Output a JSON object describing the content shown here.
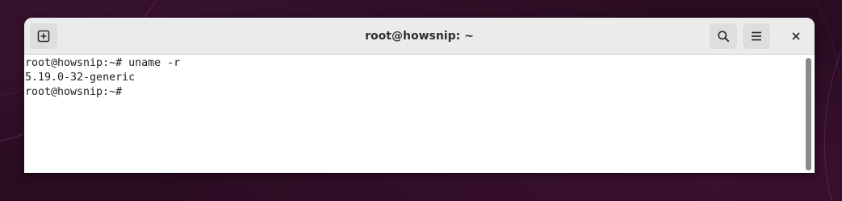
{
  "window": {
    "title": "root@howsnip: ~"
  },
  "headerbar": {
    "new_tab_icon": "plus-in-square-icon",
    "search_icon": "search-icon",
    "menu_icon": "hamburger-menu-icon",
    "close_icon": "close-icon"
  },
  "terminal": {
    "lines": [
      "root@howsnip:~# uname -r",
      "5.19.0-32-generic",
      "root@howsnip:~#"
    ]
  },
  "colors": {
    "desktop_background": "#2a0c22",
    "headerbar": "#ebebeb",
    "terminal_background": "#ffffff",
    "terminal_text": "#1e1e1e"
  }
}
